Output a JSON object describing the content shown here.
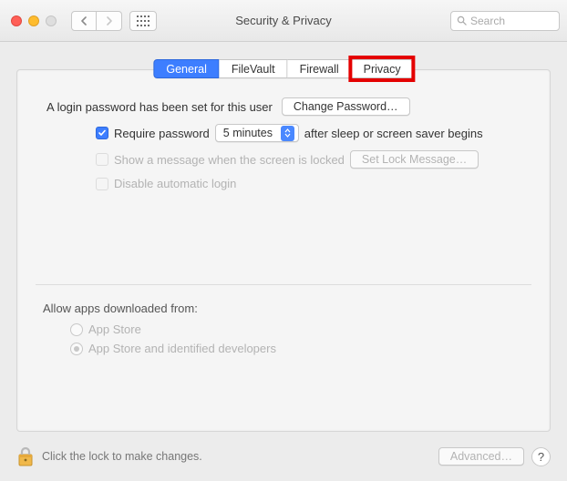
{
  "window": {
    "title": "Security & Privacy",
    "search_placeholder": "Search"
  },
  "tabs": [
    {
      "label": "General",
      "active": true
    },
    {
      "label": "FileVault",
      "active": false
    },
    {
      "label": "Firewall",
      "active": false
    },
    {
      "label": "Privacy",
      "active": false,
      "highlighted": true
    }
  ],
  "general": {
    "login_password_text": "A login password has been set for this user",
    "change_password_btn": "Change Password…",
    "require_password_label": "Require password",
    "require_password_checked": true,
    "require_password_delay": "5 minutes",
    "require_password_after_text": "after sleep or screen saver begins",
    "show_message_label": "Show a message when the screen is locked",
    "set_lock_message_btn": "Set Lock Message…",
    "disable_auto_login_label": "Disable automatic login"
  },
  "downloads": {
    "heading": "Allow apps downloaded from:",
    "options": [
      {
        "label": "App Store",
        "selected": false
      },
      {
        "label": "App Store and identified developers",
        "selected": true
      }
    ]
  },
  "footer": {
    "lock_text": "Click the lock to make changes.",
    "advanced_btn": "Advanced…",
    "help_label": "?"
  }
}
